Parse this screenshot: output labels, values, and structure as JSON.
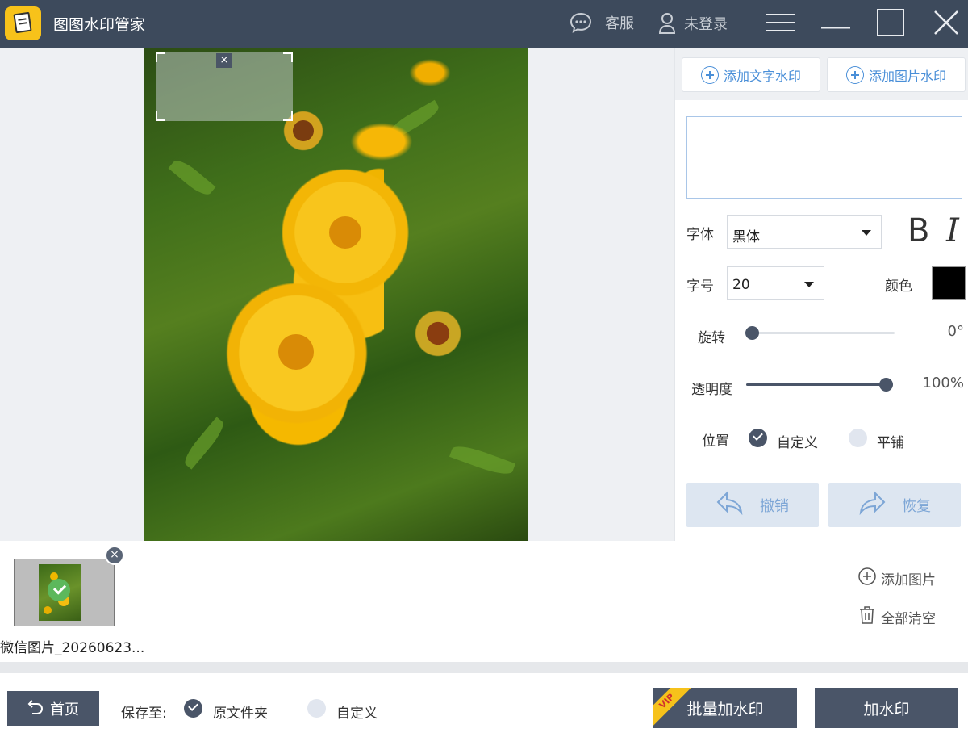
{
  "app": {
    "title": "图图水印管家"
  },
  "titlebar": {
    "service_label": "客服",
    "login_label": "未登录"
  },
  "panel": {
    "add_text_watermark": "添加文字水印",
    "add_image_watermark": "添加图片水印",
    "watermark_text_value": "",
    "font_label": "字体",
    "font_value": "黑体",
    "bold_label": "B",
    "italic_label": "I",
    "size_label": "字号",
    "size_value": "20",
    "color_label": "颜色",
    "color_value": "#000000",
    "rotation_label": "旋转",
    "rotation_value": "0°",
    "rotation_fraction": 0.0,
    "opacity_label": "透明度",
    "opacity_value": "100%",
    "opacity_fraction": 1.0,
    "position_label": "位置",
    "position_options": [
      "自定义",
      "平铺"
    ],
    "position_selected": "自定义",
    "undo_label": "撤销",
    "redo_label": "恢复"
  },
  "strip": {
    "thumbnails": [
      {
        "name": "微信图片_20260623..."
      }
    ],
    "add_image_label": "添加图片",
    "clear_all_label": "全部清空"
  },
  "bottom": {
    "home_label": "首页",
    "save_to_label": "保存至:",
    "save_options": [
      "原文件夹",
      "自定义"
    ],
    "save_selected": "原文件夹",
    "vip_badge": "VIP",
    "batch_button": "批量加水印",
    "apply_button": "加水印"
  },
  "icons": {
    "close_watermark": "×",
    "close_thumbnail": "×"
  }
}
